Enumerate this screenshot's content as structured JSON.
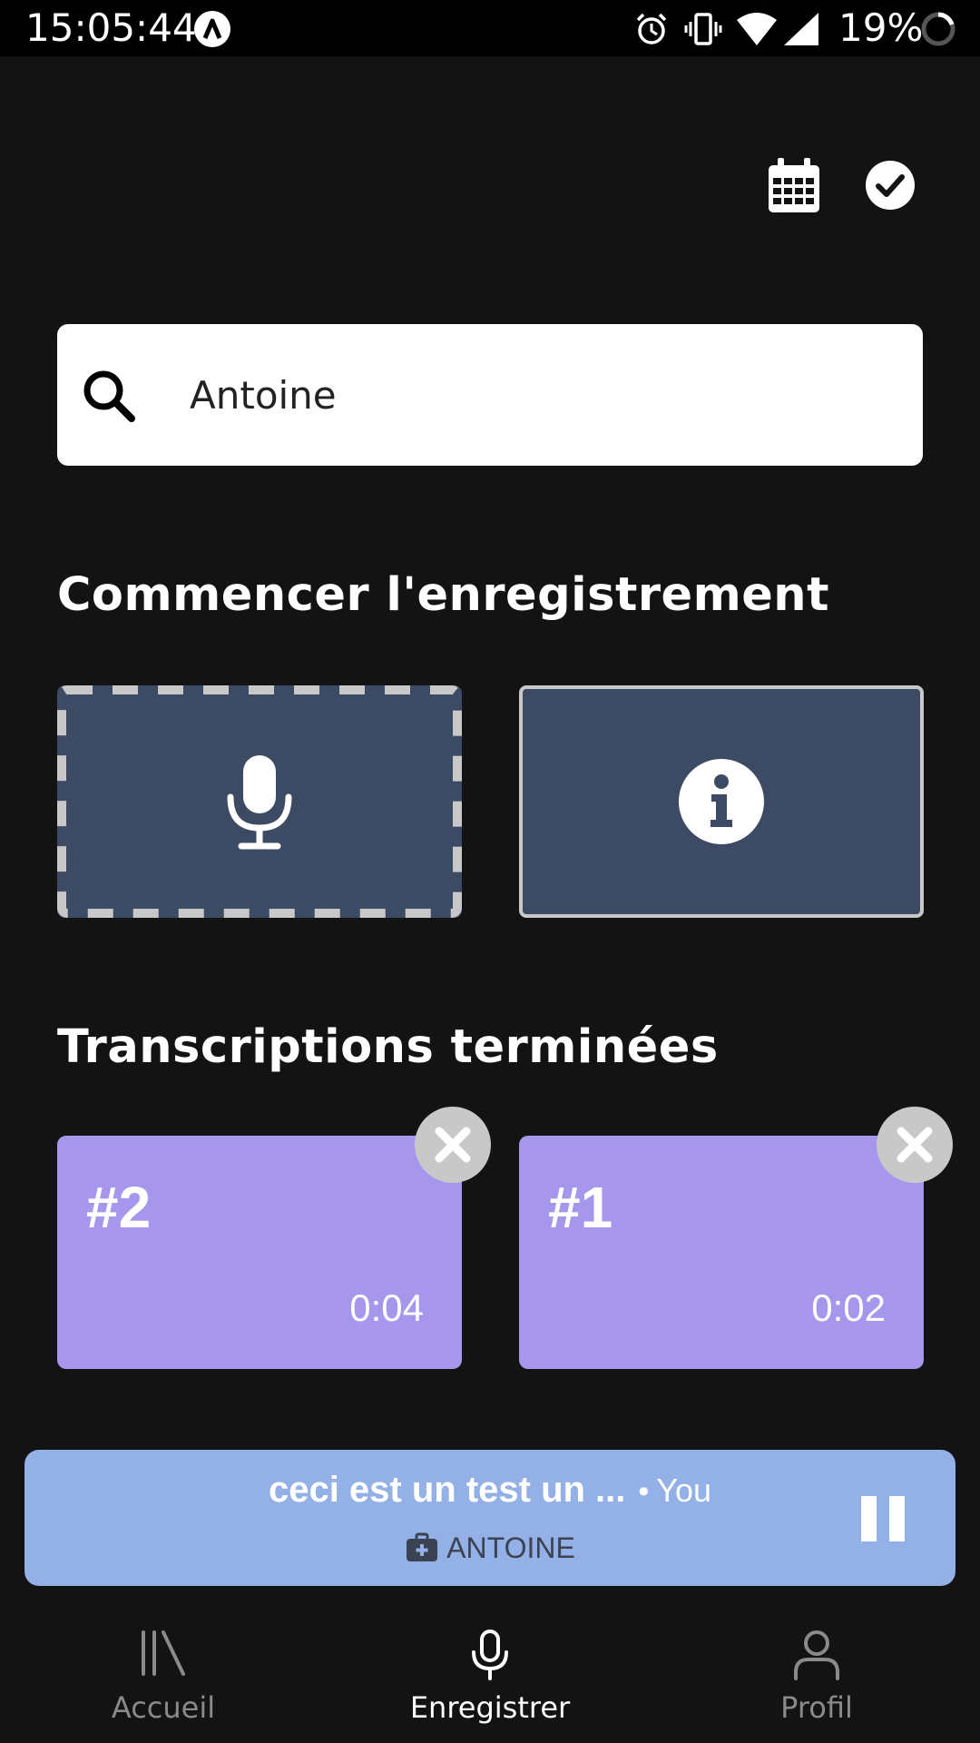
{
  "status_bar": {
    "time": "15:05:44",
    "battery": "19%"
  },
  "search": {
    "value": "Antoine"
  },
  "sections": {
    "record_title": "Commencer l'enregistrement",
    "transcriptions_title": "Transcriptions terminées"
  },
  "transcriptions": [
    {
      "number": "#2",
      "duration": "0:04"
    },
    {
      "number": "#1",
      "duration": "0:02"
    }
  ],
  "player": {
    "title": "ceci est un test un ...",
    "separator": "•",
    "artist": "You",
    "subtitle": "ANTOINE"
  },
  "nav": {
    "home": "Accueil",
    "record": "Enregistrer",
    "profile": "Profil"
  },
  "colors": {
    "background": "#131313",
    "tile": "#3d4a63",
    "card": "#a797ec",
    "player": "#93b1e6"
  },
  "icons": {
    "calendar": "calendar-icon",
    "check": "check-circle-icon",
    "search": "search-icon",
    "mic": "microphone-icon",
    "info": "info-icon",
    "close": "close-icon",
    "pause": "pause-icon",
    "medical": "medical-case-icon",
    "library": "library-icon",
    "profile": "person-icon"
  }
}
